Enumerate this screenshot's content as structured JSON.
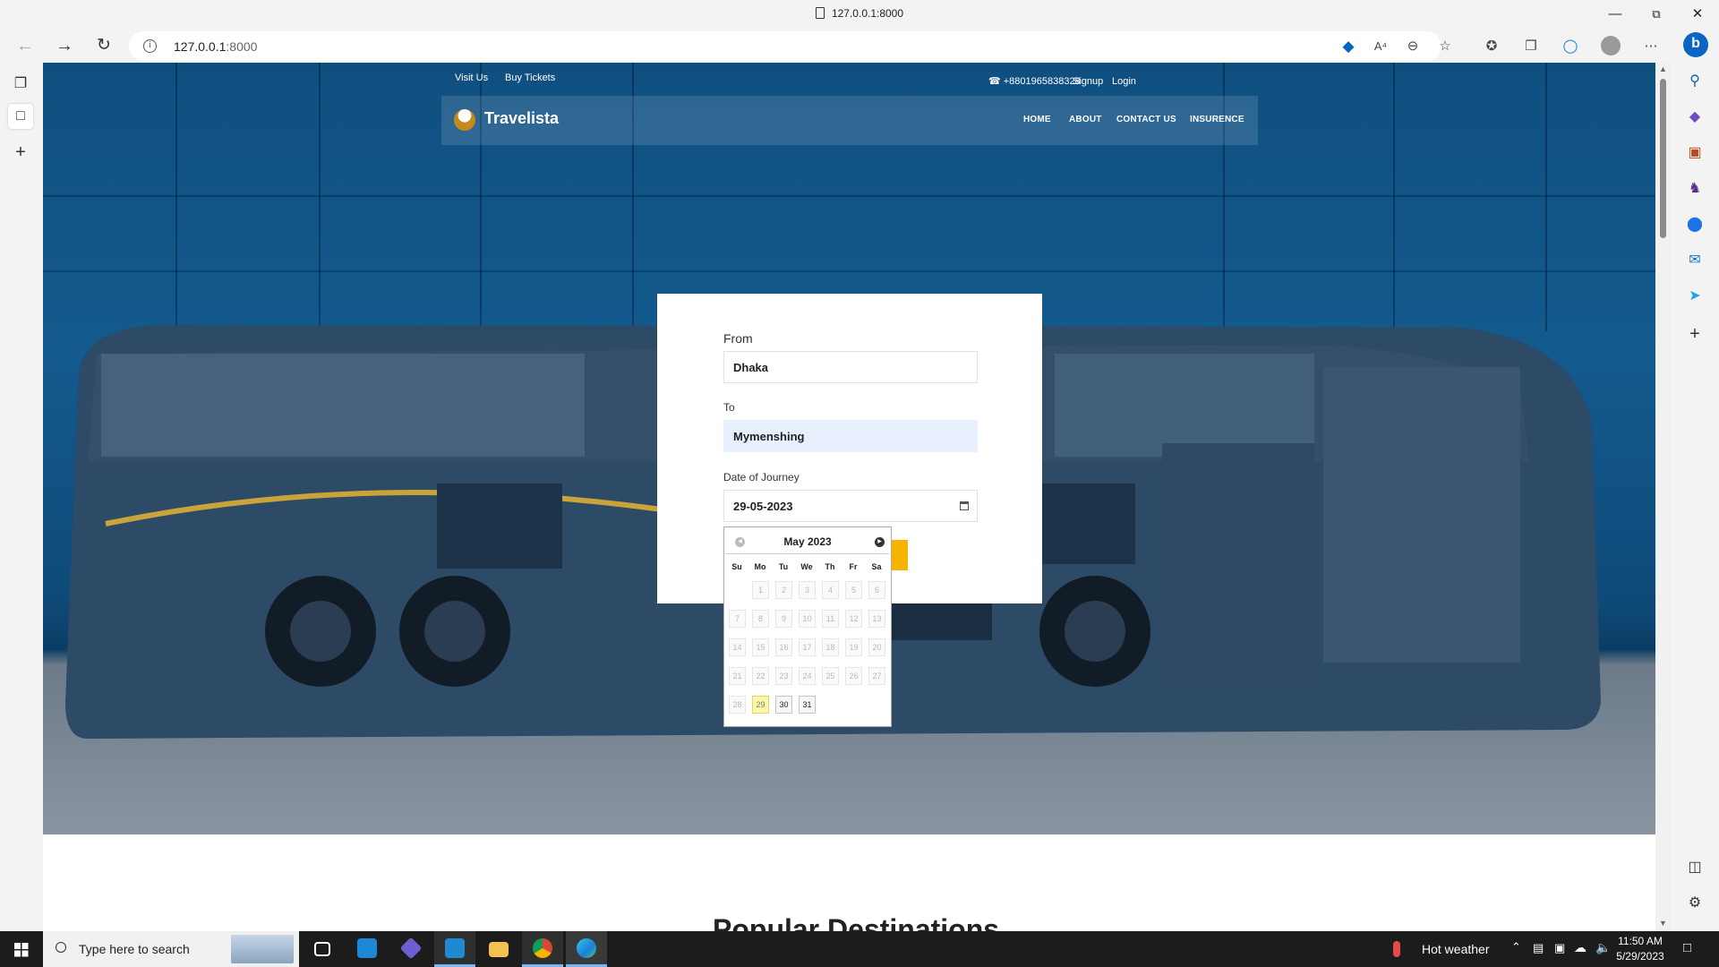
{
  "window": {
    "title": "127.0.0.1:8000"
  },
  "browser": {
    "url_host": "127.0.0.1",
    "url_port": ":8000"
  },
  "site": {
    "topbar": {
      "visit_us": "Visit Us",
      "buy_tickets": "Buy Tickets",
      "phone": "☎ +8801965838328",
      "signup": "Signup",
      "login": "Login"
    },
    "brand": "Travelista",
    "nav": [
      "HOME",
      "ABOUT",
      "CONTACT US",
      "INSURENCE"
    ],
    "form": {
      "from_label": "From",
      "from_value": "Dhaka",
      "to_label": "To",
      "to_value": "Mymenshing",
      "date_label": "Date of Journey",
      "date_value": "29-05-2023"
    },
    "datepicker": {
      "month_title": "May 2023",
      "weekdays": [
        "Su",
        "Mo",
        "Tu",
        "We",
        "Th",
        "Fr",
        "Sa"
      ],
      "weeks": [
        [
          "",
          "1",
          "2",
          "3",
          "4",
          "5",
          "6"
        ],
        [
          "7",
          "8",
          "9",
          "10",
          "11",
          "12",
          "13"
        ],
        [
          "14",
          "15",
          "16",
          "17",
          "18",
          "19",
          "20"
        ],
        [
          "21",
          "22",
          "23",
          "24",
          "25",
          "26",
          "27"
        ],
        [
          "28",
          "29",
          "30",
          "31",
          "",
          "",
          ""
        ]
      ],
      "selected_day": "29",
      "enabled_days": [
        "29",
        "30",
        "31"
      ]
    },
    "section_title": "Popular Destinations"
  },
  "taskbar": {
    "search_placeholder": "Type here to search",
    "weather": "Hot weather",
    "time": "11:50 AM",
    "date": "5/29/2023"
  },
  "colors": {
    "hero_blue": "#135a8e",
    "accent_yellow": "#f4b400",
    "edge_blue": "#0067c0"
  }
}
